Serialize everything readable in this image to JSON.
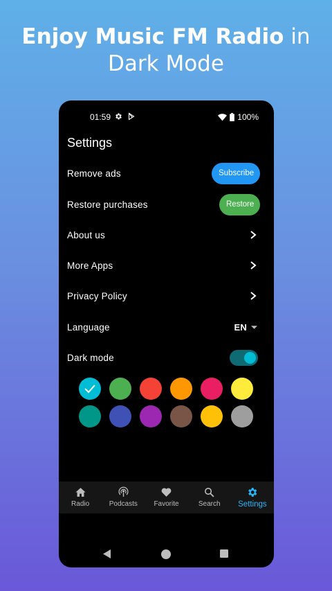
{
  "headline": {
    "bold": "Enjoy Music FM Radio",
    "rest": " in",
    "line2": "Dark Mode"
  },
  "statusbar": {
    "time": "01:59",
    "battery": "100%"
  },
  "settings": {
    "title": "Settings",
    "rows": {
      "remove_ads": {
        "label": "Remove ads",
        "button": "Subscribe"
      },
      "restore": {
        "label": "Restore purchases",
        "button": "Restore"
      },
      "about": {
        "label": "About us"
      },
      "more_apps": {
        "label": "More Apps"
      },
      "privacy": {
        "label": "Privacy Policy"
      },
      "language": {
        "label": "Language",
        "value": "EN"
      },
      "dark_mode": {
        "label": "Dark mode",
        "enabled": true
      }
    },
    "colors": {
      "selected": "#00bcd4",
      "row1": [
        "#00bcd4",
        "#4caf50",
        "#f44336",
        "#ff9800",
        "#e91e63",
        "#ffeb3b"
      ],
      "row2": [
        "#009688",
        "#3f51b5",
        "#9c27b0",
        "#795548",
        "#ffc107",
        "#9e9e9e"
      ]
    }
  },
  "bottomnav": {
    "items": [
      "Radio",
      "Podcasts",
      "Favorite",
      "Search",
      "Settings"
    ],
    "active": "Settings"
  },
  "icons": {
    "status": [
      "gear-icon",
      "play-store-icon",
      "wifi-icon",
      "battery-icon"
    ],
    "nav": [
      "home-icon",
      "podcast-icon",
      "heart-icon",
      "search-icon",
      "gear-icon"
    ],
    "system": [
      "back-icon",
      "home-circle-icon",
      "recents-icon"
    ]
  }
}
